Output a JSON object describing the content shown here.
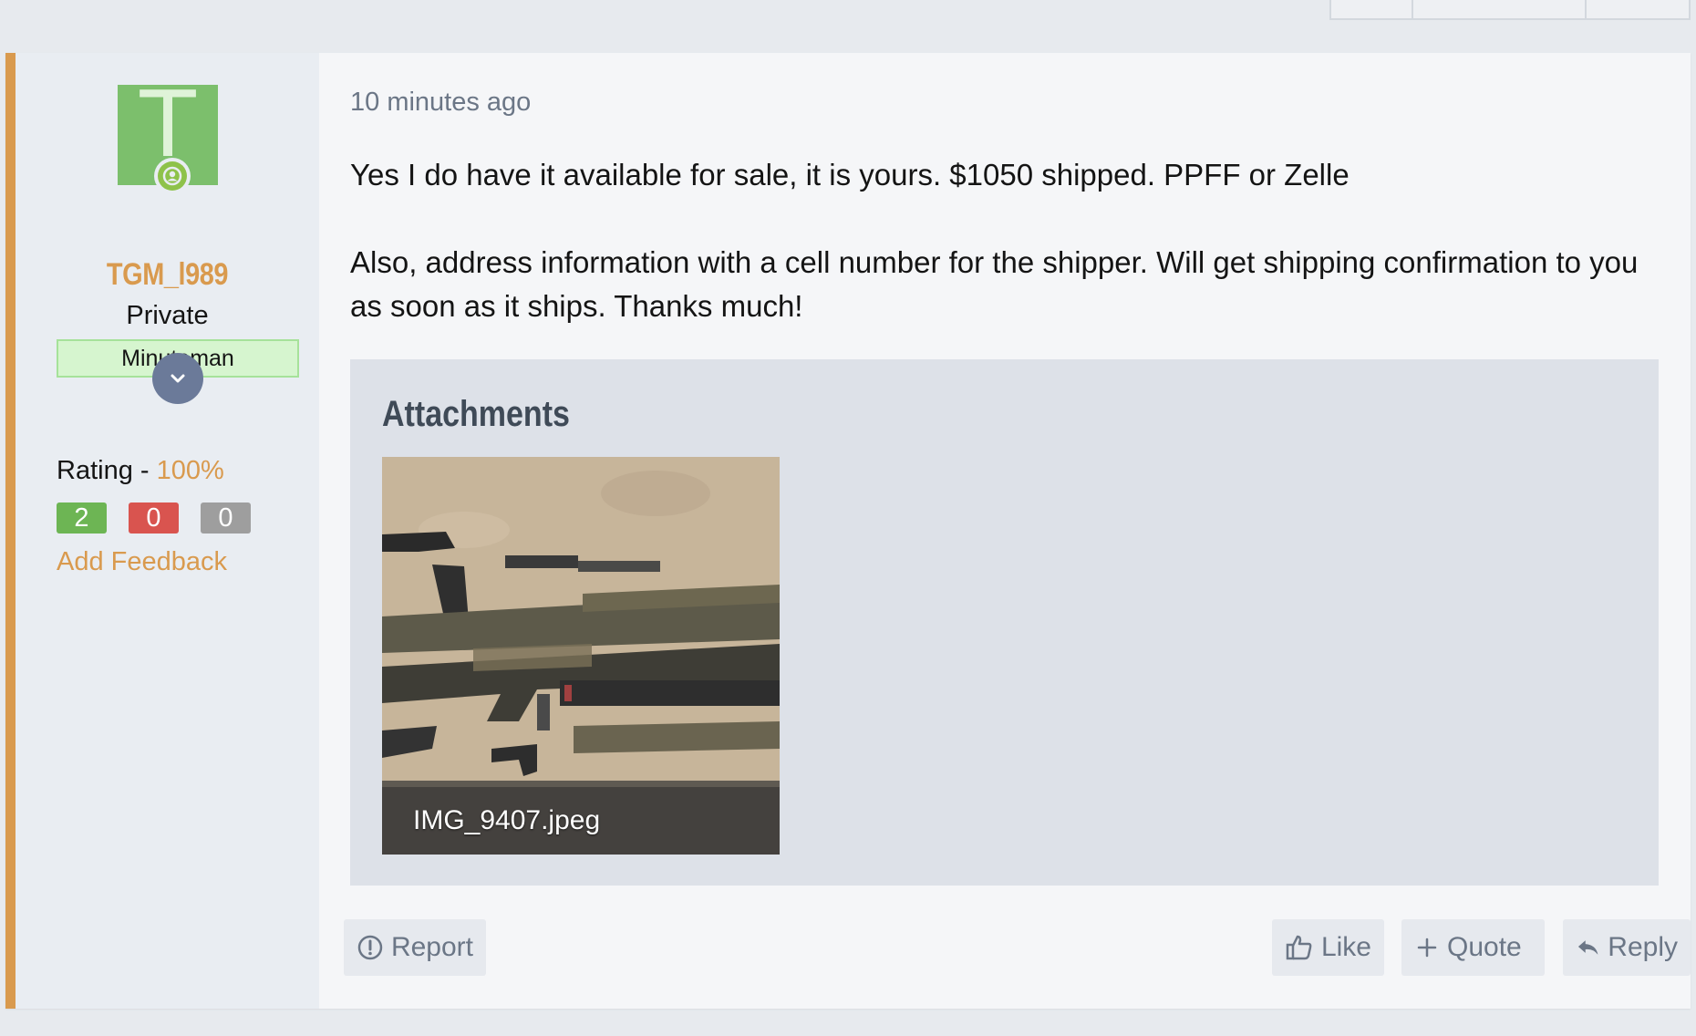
{
  "post": {
    "timestamp": "10 minutes ago",
    "message": {
      "paragraph1": "Yes I do have it available for sale, it is yours. $1050 shipped. PPFF or Zelle",
      "paragraph2": "Also, address information with a cell number for the shipper. Will get shipping confirmation to you as soon as it ships. Thanks much!"
    },
    "attachments": {
      "title": "Attachments",
      "items": [
        {
          "filename": "IMG_9407.jpeg"
        }
      ]
    },
    "actions": {
      "report": "Report",
      "like": "Like",
      "quote": "Quote",
      "reply": "Reply"
    }
  },
  "user": {
    "avatar_letter": "T",
    "username": "TGM_l989",
    "title": "Private",
    "banner": "Minuteman",
    "rating_label": "Rating - ",
    "rating_value": "100%",
    "feedback": {
      "positive": "2",
      "negative": "0",
      "neutral": "0"
    },
    "add_feedback": "Add Feedback"
  },
  "colors": {
    "accent": "#d99a4e",
    "avatar_bg": "#7cbf6c",
    "online": "#8ec24a",
    "positive": "#6db554",
    "negative": "#d9544f",
    "neutral": "#9e9e9e"
  }
}
